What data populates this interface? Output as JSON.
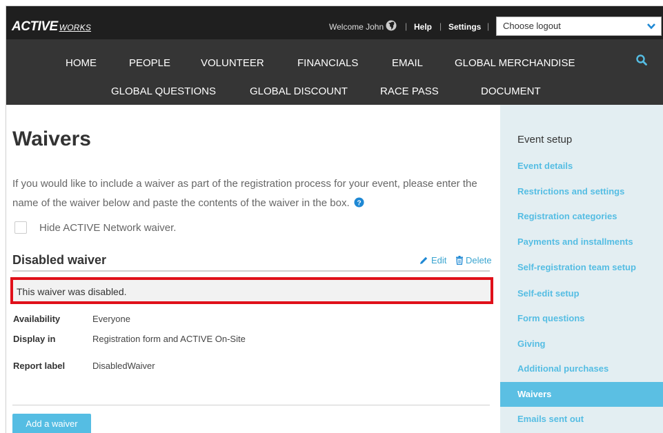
{
  "header": {
    "logo_part1": "ACTIVE",
    "logo_part2": "WORKS",
    "welcome": "Welcome John",
    "separator": "|",
    "help": "Help",
    "settings": "Settings",
    "logout_select": "Choose logout"
  },
  "nav": {
    "row1": [
      "HOME",
      "PEOPLE",
      "VOLUNTEER",
      "FINANCIALS",
      "EMAIL",
      "GLOBAL MERCHANDISE"
    ],
    "row2": [
      "GLOBAL QUESTIONS",
      "GLOBAL DISCOUNT",
      "RACE PASS",
      "DOCUMENT"
    ]
  },
  "main": {
    "title": "Waivers",
    "intro": "If you would like to include a waiver as part of the registration process for your event, please enter the name of the waiver below and paste the contents of the waiver in the box.",
    "hide_label": "Hide ACTIVE Network waiver.",
    "waiver_title": "Disabled waiver",
    "edit_label": "Edit",
    "delete_label": "Delete",
    "disabled_message": "This waiver was disabled.",
    "details": [
      {
        "label": "Availability",
        "value": "Everyone"
      },
      {
        "label": "Display in",
        "value": "Registration form and ACTIVE On-Site"
      },
      {
        "label": "Report label",
        "value": "DisabledWaiver"
      }
    ],
    "add_button": "Add a waiver"
  },
  "sidebar": {
    "title": "Event setup",
    "items": [
      {
        "label": "Event details",
        "active": false
      },
      {
        "label": "Restrictions and settings",
        "active": false
      },
      {
        "label": "Registration categories",
        "active": false
      },
      {
        "label": "Payments and installments",
        "active": false
      },
      {
        "label": "Self-registration team setup",
        "active": false
      },
      {
        "label": "Self-edit setup",
        "active": false
      },
      {
        "label": "Form questions",
        "active": false
      },
      {
        "label": "Giving",
        "active": false
      },
      {
        "label": "Additional purchases",
        "active": false
      },
      {
        "label": "Waivers",
        "active": true
      },
      {
        "label": "Emails sent out",
        "active": false
      }
    ]
  },
  "colors": {
    "accent": "#55bde3",
    "highlight_border": "#e0101a",
    "topbar": "#1f1f1f",
    "nav": "#353535"
  }
}
